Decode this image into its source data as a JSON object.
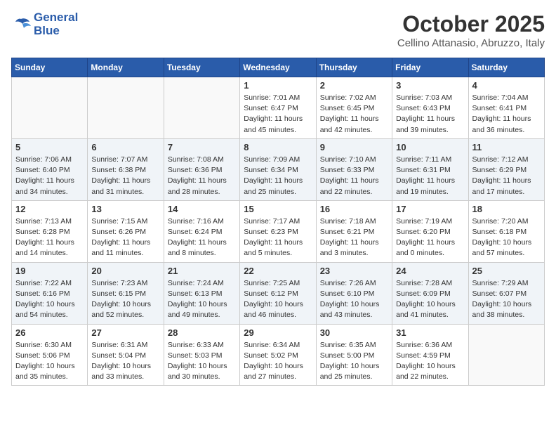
{
  "header": {
    "logo_line1": "General",
    "logo_line2": "Blue",
    "month": "October 2025",
    "location": "Cellino Attanasio, Abruzzo, Italy"
  },
  "weekdays": [
    "Sunday",
    "Monday",
    "Tuesday",
    "Wednesday",
    "Thursday",
    "Friday",
    "Saturday"
  ],
  "weeks": [
    [
      {
        "day": "",
        "info": ""
      },
      {
        "day": "",
        "info": ""
      },
      {
        "day": "",
        "info": ""
      },
      {
        "day": "1",
        "info": "Sunrise: 7:01 AM\nSunset: 6:47 PM\nDaylight: 11 hours\nand 45 minutes."
      },
      {
        "day": "2",
        "info": "Sunrise: 7:02 AM\nSunset: 6:45 PM\nDaylight: 11 hours\nand 42 minutes."
      },
      {
        "day": "3",
        "info": "Sunrise: 7:03 AM\nSunset: 6:43 PM\nDaylight: 11 hours\nand 39 minutes."
      },
      {
        "day": "4",
        "info": "Sunrise: 7:04 AM\nSunset: 6:41 PM\nDaylight: 11 hours\nand 36 minutes."
      }
    ],
    [
      {
        "day": "5",
        "info": "Sunrise: 7:06 AM\nSunset: 6:40 PM\nDaylight: 11 hours\nand 34 minutes."
      },
      {
        "day": "6",
        "info": "Sunrise: 7:07 AM\nSunset: 6:38 PM\nDaylight: 11 hours\nand 31 minutes."
      },
      {
        "day": "7",
        "info": "Sunrise: 7:08 AM\nSunset: 6:36 PM\nDaylight: 11 hours\nand 28 minutes."
      },
      {
        "day": "8",
        "info": "Sunrise: 7:09 AM\nSunset: 6:34 PM\nDaylight: 11 hours\nand 25 minutes."
      },
      {
        "day": "9",
        "info": "Sunrise: 7:10 AM\nSunset: 6:33 PM\nDaylight: 11 hours\nand 22 minutes."
      },
      {
        "day": "10",
        "info": "Sunrise: 7:11 AM\nSunset: 6:31 PM\nDaylight: 11 hours\nand 19 minutes."
      },
      {
        "day": "11",
        "info": "Sunrise: 7:12 AM\nSunset: 6:29 PM\nDaylight: 11 hours\nand 17 minutes."
      }
    ],
    [
      {
        "day": "12",
        "info": "Sunrise: 7:13 AM\nSunset: 6:28 PM\nDaylight: 11 hours\nand 14 minutes."
      },
      {
        "day": "13",
        "info": "Sunrise: 7:15 AM\nSunset: 6:26 PM\nDaylight: 11 hours\nand 11 minutes."
      },
      {
        "day": "14",
        "info": "Sunrise: 7:16 AM\nSunset: 6:24 PM\nDaylight: 11 hours\nand 8 minutes."
      },
      {
        "day": "15",
        "info": "Sunrise: 7:17 AM\nSunset: 6:23 PM\nDaylight: 11 hours\nand 5 minutes."
      },
      {
        "day": "16",
        "info": "Sunrise: 7:18 AM\nSunset: 6:21 PM\nDaylight: 11 hours\nand 3 minutes."
      },
      {
        "day": "17",
        "info": "Sunrise: 7:19 AM\nSunset: 6:20 PM\nDaylight: 11 hours\nand 0 minutes."
      },
      {
        "day": "18",
        "info": "Sunrise: 7:20 AM\nSunset: 6:18 PM\nDaylight: 10 hours\nand 57 minutes."
      }
    ],
    [
      {
        "day": "19",
        "info": "Sunrise: 7:22 AM\nSunset: 6:16 PM\nDaylight: 10 hours\nand 54 minutes."
      },
      {
        "day": "20",
        "info": "Sunrise: 7:23 AM\nSunset: 6:15 PM\nDaylight: 10 hours\nand 52 minutes."
      },
      {
        "day": "21",
        "info": "Sunrise: 7:24 AM\nSunset: 6:13 PM\nDaylight: 10 hours\nand 49 minutes."
      },
      {
        "day": "22",
        "info": "Sunrise: 7:25 AM\nSunset: 6:12 PM\nDaylight: 10 hours\nand 46 minutes."
      },
      {
        "day": "23",
        "info": "Sunrise: 7:26 AM\nSunset: 6:10 PM\nDaylight: 10 hours\nand 43 minutes."
      },
      {
        "day": "24",
        "info": "Sunrise: 7:28 AM\nSunset: 6:09 PM\nDaylight: 10 hours\nand 41 minutes."
      },
      {
        "day": "25",
        "info": "Sunrise: 7:29 AM\nSunset: 6:07 PM\nDaylight: 10 hours\nand 38 minutes."
      }
    ],
    [
      {
        "day": "26",
        "info": "Sunrise: 6:30 AM\nSunset: 5:06 PM\nDaylight: 10 hours\nand 35 minutes."
      },
      {
        "day": "27",
        "info": "Sunrise: 6:31 AM\nSunset: 5:04 PM\nDaylight: 10 hours\nand 33 minutes."
      },
      {
        "day": "28",
        "info": "Sunrise: 6:33 AM\nSunset: 5:03 PM\nDaylight: 10 hours\nand 30 minutes."
      },
      {
        "day": "29",
        "info": "Sunrise: 6:34 AM\nSunset: 5:02 PM\nDaylight: 10 hours\nand 27 minutes."
      },
      {
        "day": "30",
        "info": "Sunrise: 6:35 AM\nSunset: 5:00 PM\nDaylight: 10 hours\nand 25 minutes."
      },
      {
        "day": "31",
        "info": "Sunrise: 6:36 AM\nSunset: 4:59 PM\nDaylight: 10 hours\nand 22 minutes."
      },
      {
        "day": "",
        "info": ""
      }
    ]
  ]
}
